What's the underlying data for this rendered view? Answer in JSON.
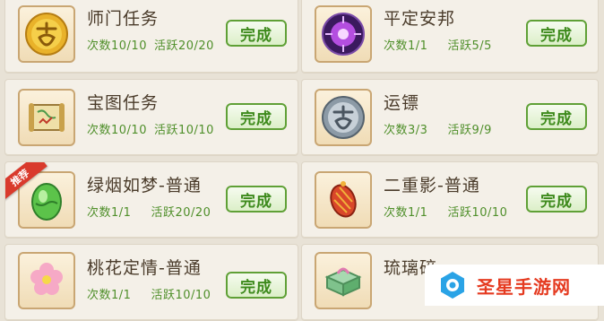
{
  "tasks": [
    {
      "title": "师门任务",
      "count": "次数10/10",
      "activity": "活跃20/20",
      "button": "完成",
      "icon": "dream-coin-icon"
    },
    {
      "title": "平定安邦",
      "count": "次数1/1",
      "activity": "活跃5/5",
      "button": "完成",
      "icon": "purple-orb-icon"
    },
    {
      "title": "宝图任务",
      "count": "次数10/10",
      "activity": "活跃10/10",
      "button": "完成",
      "icon": "treasure-map-scroll-icon"
    },
    {
      "title": "运镖",
      "count": "次数3/3",
      "activity": "活跃9/9",
      "button": "完成",
      "icon": "silver-coin-icon"
    },
    {
      "title": "绿烟如梦-普通",
      "count": "次数1/1",
      "activity": "活跃20/20",
      "button": "完成",
      "icon": "green-egg-icon",
      "badge": "推荐"
    },
    {
      "title": "二重影-普通",
      "count": "次数1/1",
      "activity": "活跃10/10",
      "button": "完成",
      "icon": "red-lantern-icon"
    },
    {
      "title": "桃花定情-普通",
      "count": "次数1/1",
      "activity": "活跃10/10",
      "button": "完成",
      "icon": "peach-blossom-icon"
    },
    {
      "title": "琉璃碎",
      "count": "",
      "activity": "",
      "button": "",
      "icon": "jade-box-icon"
    }
  ],
  "watermark": {
    "text": "圣星手游网",
    "icon": "star-logo-icon"
  },
  "colors": {
    "stats_green": "#4f8f2a",
    "button_green": "#5fa036",
    "badge_red": "#d93a2c",
    "watermark_red": "#e53a20"
  }
}
